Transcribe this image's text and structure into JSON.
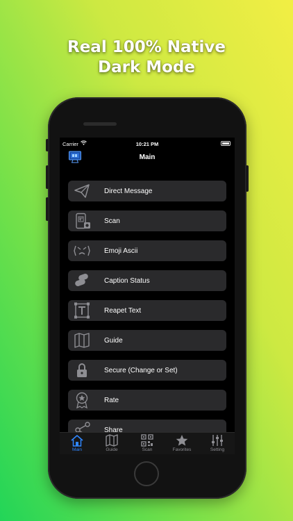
{
  "headline": {
    "line1": "Real 100% Native",
    "line2": "Dark Mode"
  },
  "status_bar": {
    "carrier": "Carrier",
    "time": "10:21 PM"
  },
  "nav": {
    "title": "Main",
    "left_icon": "monitor-icon"
  },
  "menu": {
    "items": [
      {
        "label": "Direct Message",
        "icon": "paper-plane-icon"
      },
      {
        "label": "Scan",
        "icon": "phone-scan-icon"
      },
      {
        "label": "Emoji Ascii",
        "icon": "emoji-face-icon"
      },
      {
        "label": "Caption Status",
        "icon": "pills-icon"
      },
      {
        "label": "Reapet Text",
        "icon": "text-frame-icon"
      },
      {
        "label": "Guide",
        "icon": "map-icon"
      },
      {
        "label": "Secure (Change or Set)",
        "icon": "lock-icon"
      },
      {
        "label": "Rate",
        "icon": "award-icon"
      },
      {
        "label": "Share",
        "icon": "share-icon"
      }
    ]
  },
  "tabbar": {
    "tabs": [
      {
        "label": "Main",
        "icon": "home-icon",
        "active": true
      },
      {
        "label": "Guide",
        "icon": "map-icon",
        "active": false
      },
      {
        "label": "Scan",
        "icon": "qr-code-icon",
        "active": false
      },
      {
        "label": "Favorites",
        "icon": "star-icon",
        "active": false
      },
      {
        "label": "Setting",
        "icon": "sliders-icon",
        "active": false
      }
    ]
  },
  "colors": {
    "accent": "#2f86ff",
    "row_background": "#2a2a2c",
    "icon_gray": "#8e8e93",
    "gradient_start": "#22d558",
    "gradient_end": "#f2ee44"
  }
}
